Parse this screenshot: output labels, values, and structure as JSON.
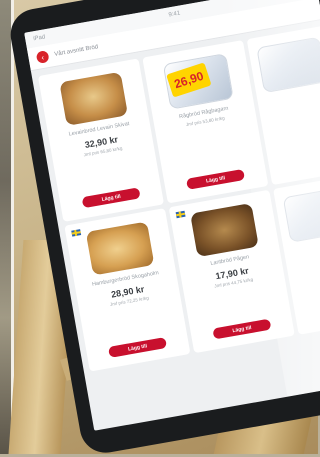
{
  "screen": {
    "status_left": "iPad",
    "status_center": "9:41",
    "category_title": "Vårt avsnitt Bröd",
    "back_icon": "chevron-left-icon"
  },
  "products": [
    {
      "name": "Levainbröd Levain Skivat",
      "price": "32,90 kr",
      "unit_price": "Jmf pris 65,80 kr/kg",
      "button": "Lägg till",
      "image": "bread"
    },
    {
      "name": "Rågbröd Rågbagarn",
      "price": "26,90",
      "unit_price": "Jmf pris 53,80 kr/kg",
      "button": "Lägg till",
      "image": "pack",
      "badge": "26,90"
    },
    {
      "name": "",
      "price": "",
      "unit_price": "",
      "button": "",
      "image": "pack"
    },
    {
      "name": "Hamburgerbröd Skogaholm",
      "price": "28,90 kr",
      "unit_price": "Jmf pris 72,25 kr/kg",
      "button": "Lägg till",
      "image": "rolls"
    },
    {
      "name": "Lantbröd Pågen",
      "price": "17,90 kr",
      "unit_price": "Jmf pris 44,75 kr/kg",
      "button": "Lägg till",
      "image": "dark"
    },
    {
      "name": "",
      "price": "",
      "unit_price": "",
      "button": "",
      "image": "pack"
    }
  ],
  "colors": {
    "accent": "#c8102e",
    "badge": "#ffd400"
  }
}
